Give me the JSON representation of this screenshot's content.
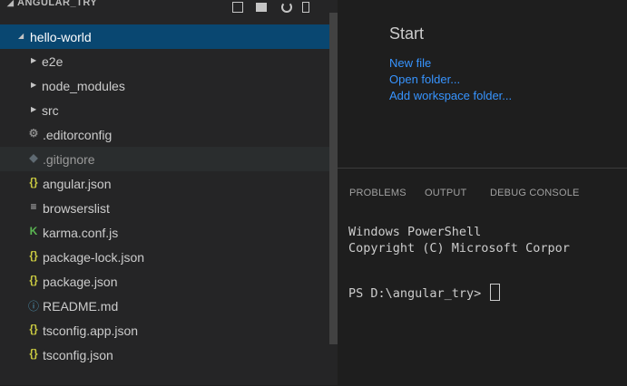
{
  "explorer": {
    "title": "ANGULAR_TRY",
    "actions": [
      "new-file-icon",
      "new-folder-icon",
      "refresh-icon",
      "collapse-all-icon"
    ]
  },
  "tree": {
    "root": "hello-world",
    "folders": [
      "e2e",
      "node_modules",
      "src"
    ],
    "files": [
      {
        "name": ".editorconfig",
        "icon": "gear-icon"
      },
      {
        "name": ".gitignore",
        "icon": "git-icon"
      },
      {
        "name": "angular.json",
        "icon": "json-icon"
      },
      {
        "name": "browserslist",
        "icon": "list-icon"
      },
      {
        "name": "karma.conf.js",
        "icon": "karma-icon"
      },
      {
        "name": "package-lock.json",
        "icon": "json-icon"
      },
      {
        "name": "package.json",
        "icon": "json-icon"
      },
      {
        "name": "README.md",
        "icon": "info-icon"
      },
      {
        "name": "tsconfig.app.json",
        "icon": "json-icon"
      },
      {
        "name": "tsconfig.json",
        "icon": "json-icon"
      }
    ]
  },
  "welcome": {
    "heading": "Start",
    "links": [
      "New file",
      "Open folder...",
      "Add workspace folder..."
    ]
  },
  "panel": {
    "tabs": [
      "PROBLEMS",
      "OUTPUT",
      "DEBUG CONSOLE"
    ],
    "terminal": {
      "line1": "Windows PowerShell",
      "line2": "Copyright (C) Microsoft Corpor",
      "prompt": "PS D:\\angular_try> "
    }
  },
  "colors": {
    "selection": "#094771",
    "link": "#3794ff",
    "json_icon": "#cbcb41",
    "karma_icon": "#5ab552",
    "info_icon": "#519aba"
  }
}
